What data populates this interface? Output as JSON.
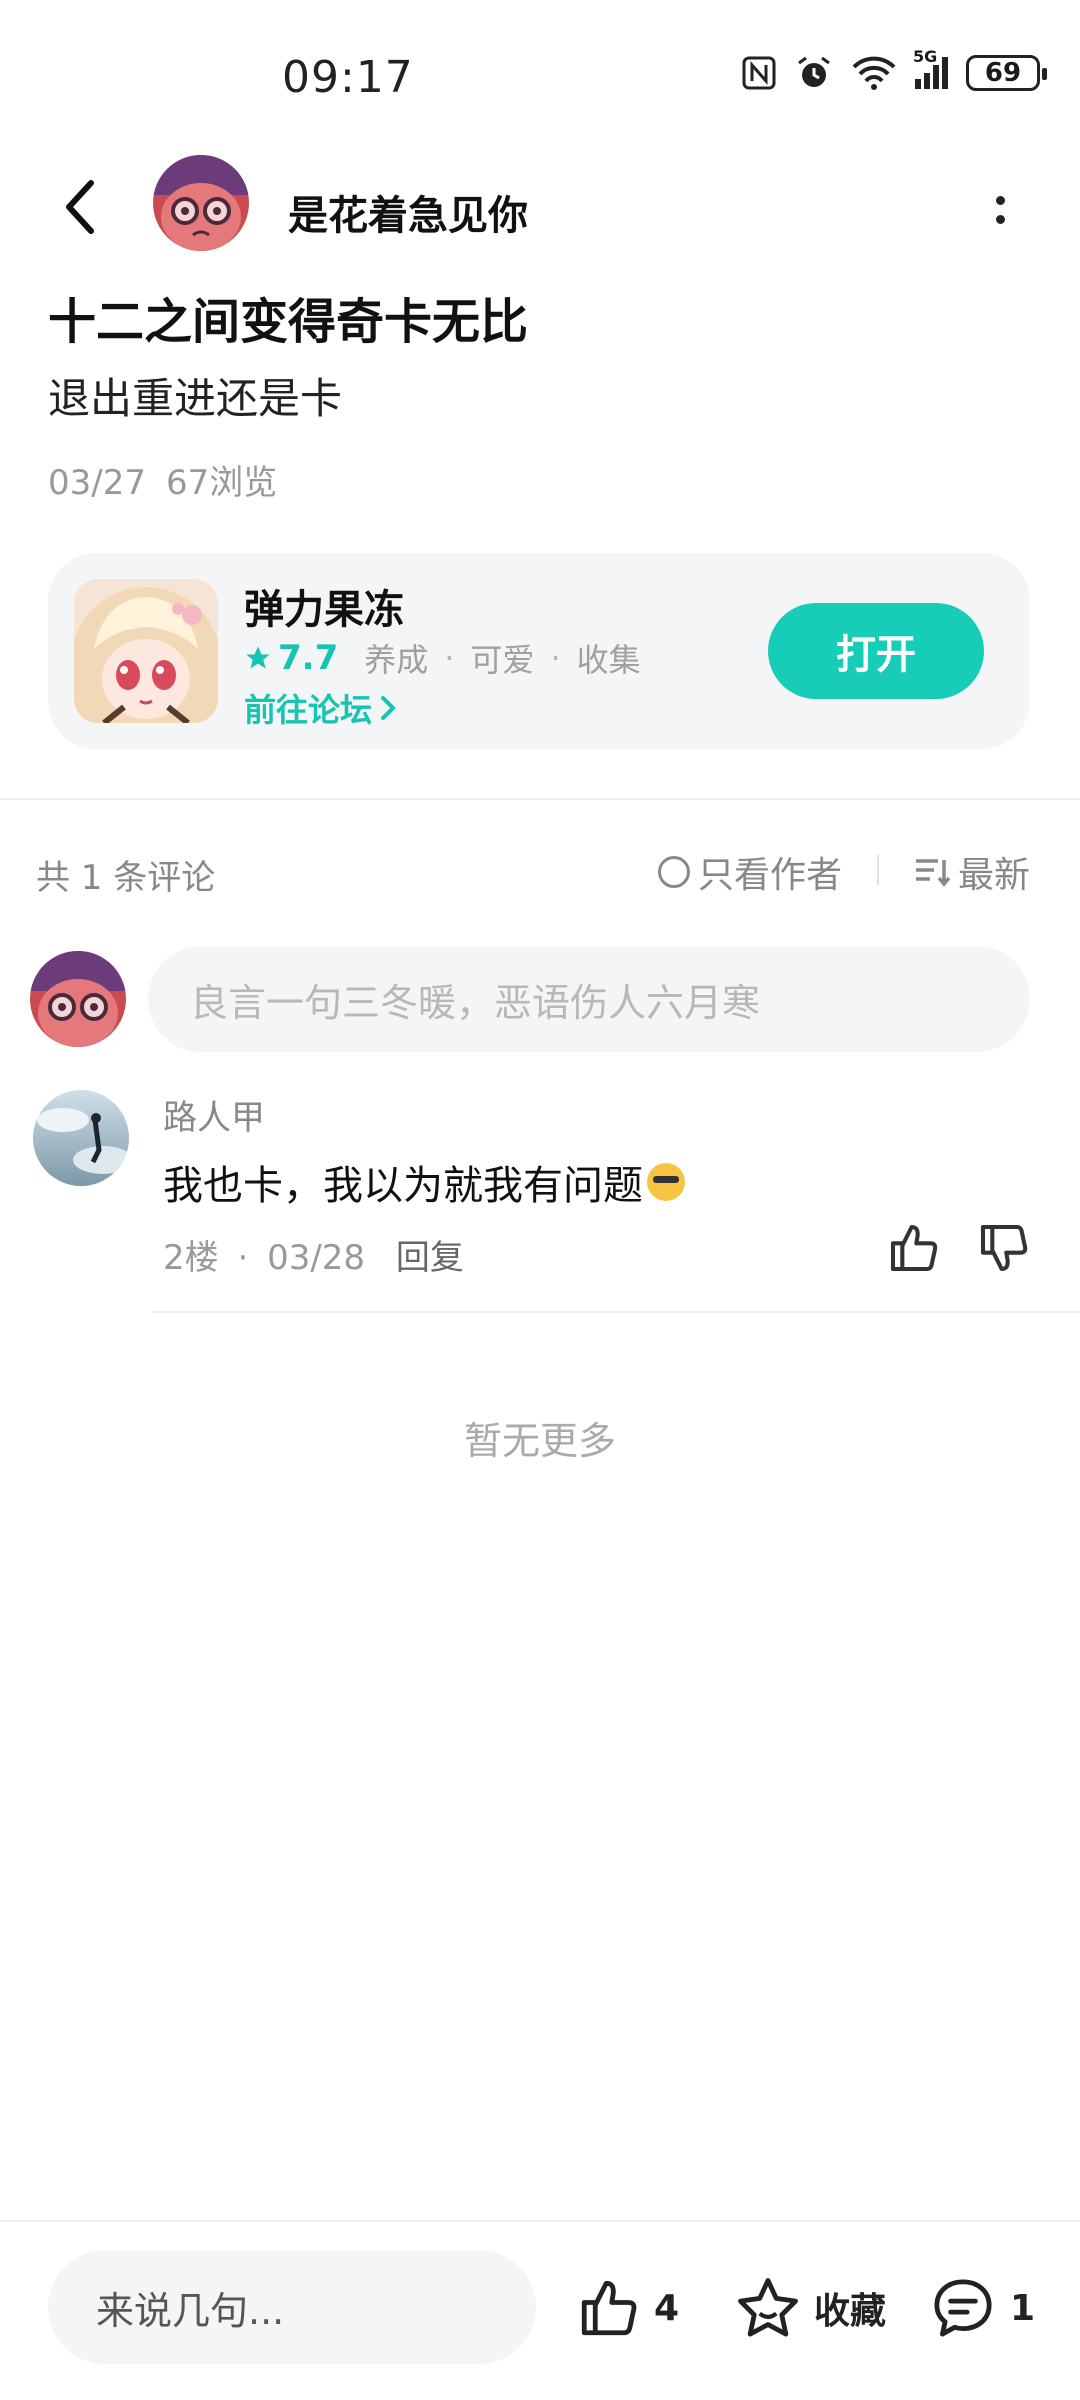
{
  "status_bar": {
    "time": "09:17",
    "battery": "69",
    "network": "5G"
  },
  "header": {
    "author_name": "是花着急见你"
  },
  "post": {
    "title": "十二之间变得奇卡无比",
    "body": "退出重进还是卡",
    "date": "03/27",
    "views": "67浏览"
  },
  "game_card": {
    "name": "弹力果冻",
    "rating": "7.7",
    "tags": [
      "养成",
      "可爱",
      "收集"
    ],
    "forum_link": "前往论坛",
    "open_button": "打开",
    "accent": "#17cdb7"
  },
  "comments": {
    "count_label": "共 1 条评论",
    "author_only": "只看作者",
    "sort": "最新",
    "input_placeholder": "良言一句三冬暖，恶语伤人六月寒",
    "items": [
      {
        "user": "路人甲",
        "text": "我也卡，我以为就我有问题",
        "floor": "2楼",
        "date": "03/28",
        "reply": "回复"
      }
    ],
    "no_more": "暂无更多"
  },
  "bottom_bar": {
    "input_placeholder": "来说几句...",
    "likes": "4",
    "favorite_label": "收藏",
    "comment_count": "1"
  }
}
